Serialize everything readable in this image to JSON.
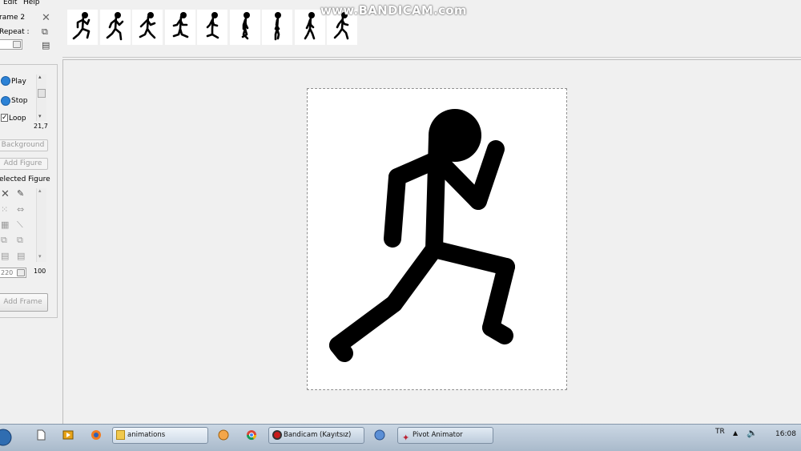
{
  "menu": {
    "edit": "Edit",
    "help": "Help"
  },
  "watermark": "www.BANDICAM.com",
  "frame_panel": {
    "frame_label": "rame 2",
    "repeat_label": "Repeat :"
  },
  "playback": {
    "play": "Play",
    "stop": "Stop",
    "loop": "Loop",
    "loop_checked": true,
    "speed_value": "21,7"
  },
  "buttons": {
    "background": "Background",
    "add_figure": "Add Figure",
    "add_frame": "Add Frame"
  },
  "selected_figure": {
    "label": "elected Figure",
    "size_value": "220",
    "opacity_value": "100"
  },
  "taskbar": {
    "items": [
      {
        "label": "animations"
      },
      {
        "label": "Bandicam (Kayıtsız)"
      },
      {
        "label": "Pivot Animator"
      }
    ],
    "lang": "TR",
    "time": "16:08"
  },
  "colors": {
    "accent_play": "#2c82d6",
    "stage_bg": "#ffffff",
    "figure": "#000000"
  },
  "icons": {
    "delete_frame": "close-x-icon",
    "copy": "copy-icon",
    "paste": "paste-icon",
    "figure_tools": [
      "delete-icon",
      "pencil-icon",
      "move-icon",
      "flip-icon",
      "grid-icon",
      "line-icon",
      "copy-icon",
      "copy-icon",
      "paste-icon",
      "paste-icon"
    ]
  }
}
